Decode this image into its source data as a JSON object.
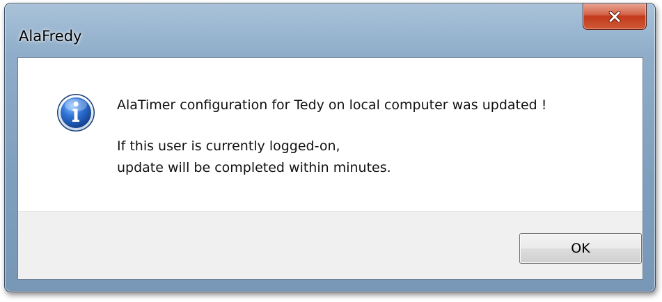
{
  "window": {
    "title": "AlaFredy",
    "close_icon": "close-x-icon"
  },
  "message": {
    "icon": "information-icon",
    "main": "AlaTimer configuration for Tedy on local computer was updated !",
    "line1": "If this user is currently logged-on,",
    "line2": "update will be completed within minutes."
  },
  "buttons": {
    "ok_label": "OK"
  },
  "colors": {
    "frame": "#8fadc9",
    "close_button": "#c23a1c",
    "info_icon": "#1f63c4",
    "button_area": "#f0f0f0"
  }
}
